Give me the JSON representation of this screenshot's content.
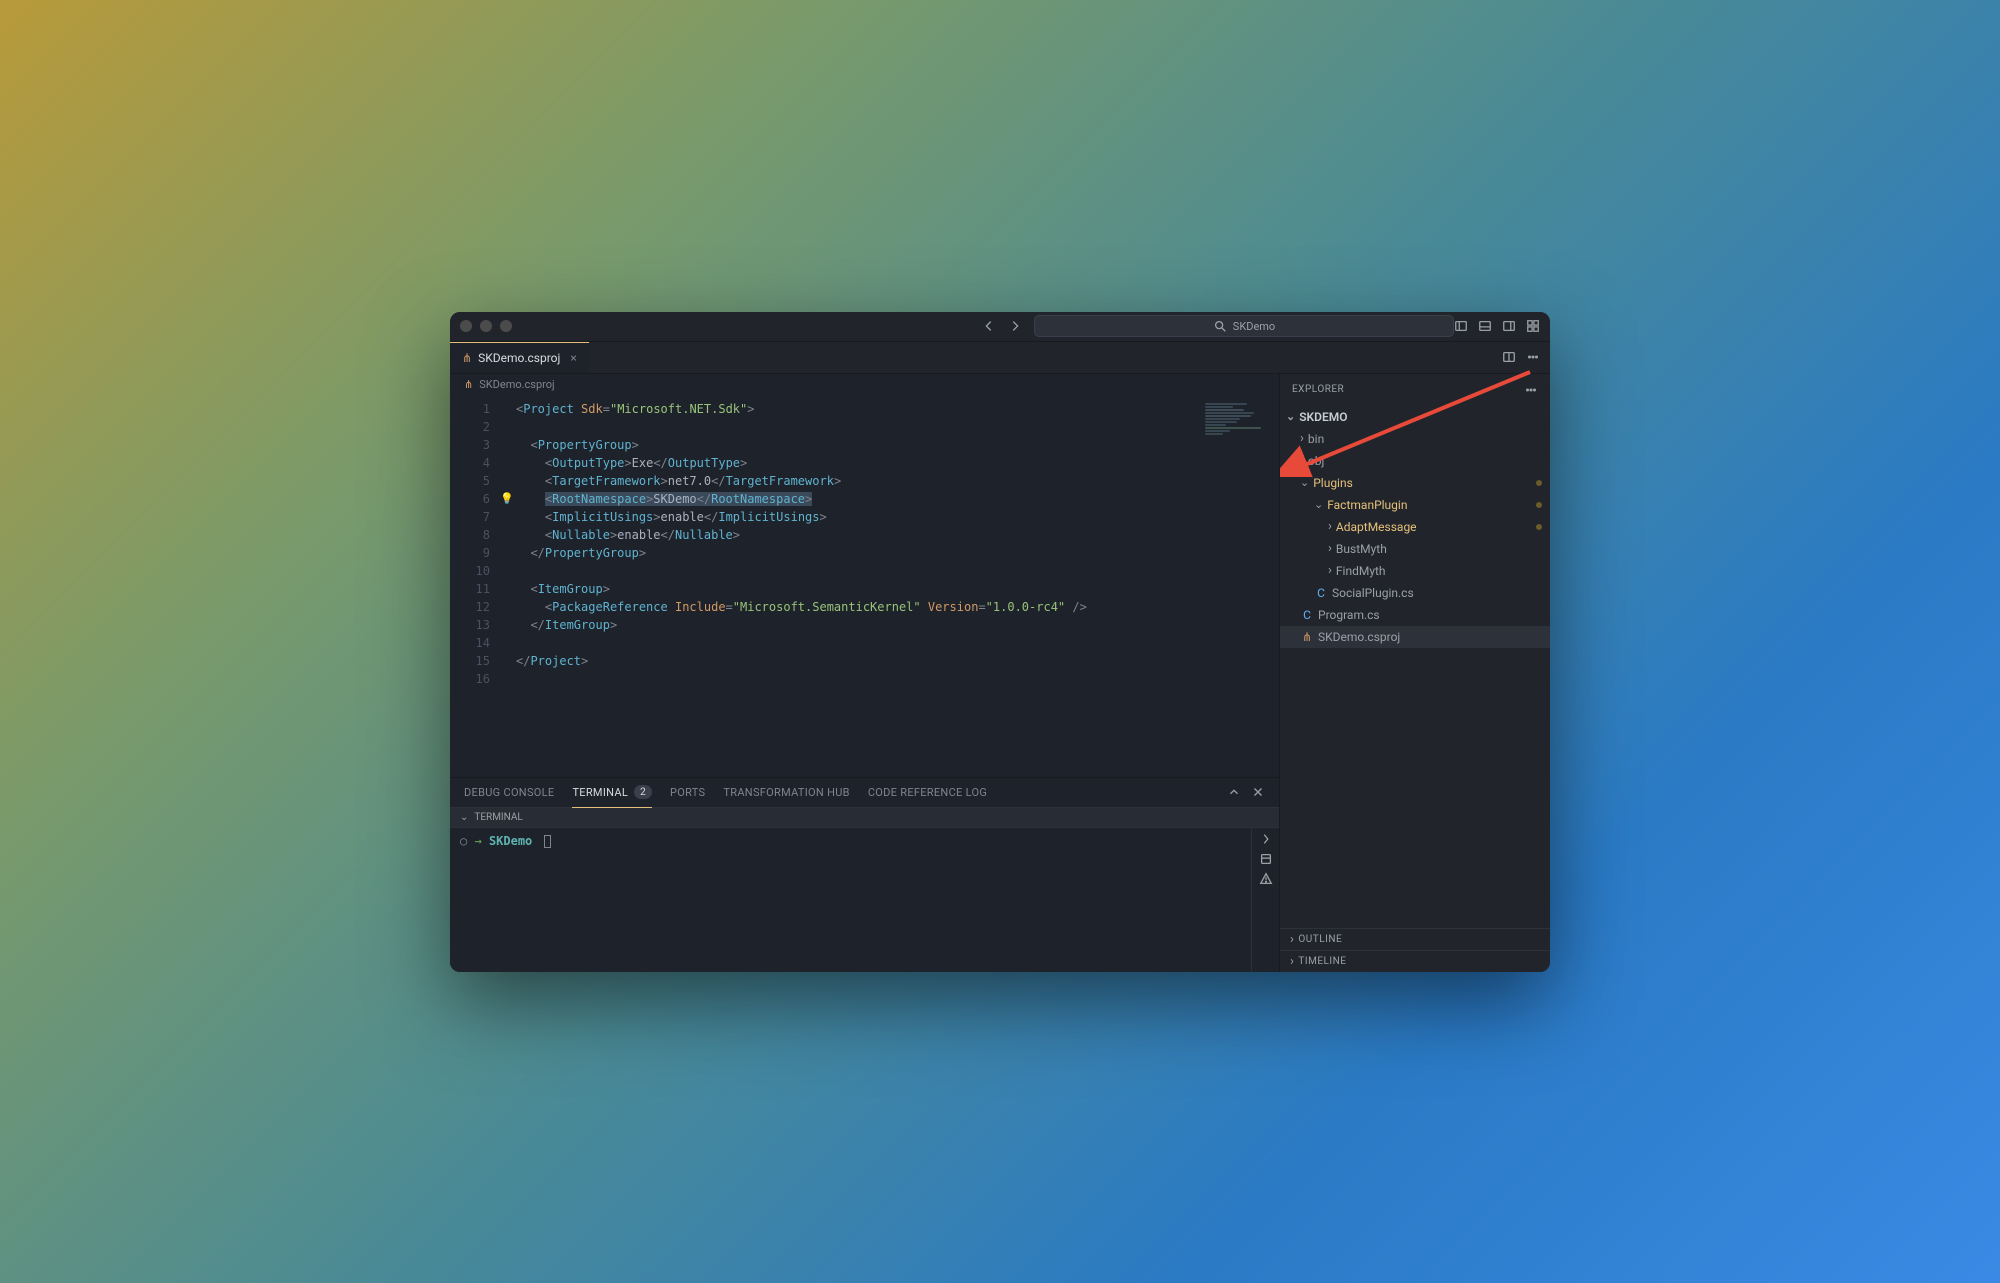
{
  "titlebar": {
    "search_placeholder": "SKDemo"
  },
  "tab": {
    "filename": "SKDemo.csproj",
    "close": "×"
  },
  "breadcrumb": {
    "filename": "SKDemo.csproj"
  },
  "code": {
    "lines": [
      {
        "n": 1,
        "html": "<span class='t-pun'>&lt;</span><span class='t-tag'>Project</span> <span class='t-attr'>Sdk</span><span class='t-pun'>=</span><span class='t-str'>\"Microsoft.NET.Sdk\"</span><span class='t-pun'>&gt;</span>"
      },
      {
        "n": 2,
        "html": ""
      },
      {
        "n": 3,
        "html": "  <span class='t-pun'>&lt;</span><span class='t-tag'>PropertyGroup</span><span class='t-pun'>&gt;</span>"
      },
      {
        "n": 4,
        "html": "    <span class='t-pun'>&lt;</span><span class='t-tag'>OutputType</span><span class='t-pun'>&gt;</span><span class='t-txt'>Exe</span><span class='t-pun'>&lt;/</span><span class='t-tag'>OutputType</span><span class='t-pun'>&gt;</span>"
      },
      {
        "n": 5,
        "html": "    <span class='t-pun'>&lt;</span><span class='t-tag'>TargetFramework</span><span class='t-pun'>&gt;</span><span class='t-txt'>net7.0</span><span class='t-pun'>&lt;/</span><span class='t-tag'>TargetFramework</span><span class='t-pun'>&gt;</span>"
      },
      {
        "n": 6,
        "html": "    <span class='hl'><span class='t-pun'>&lt;</span><span class='t-tag'>RootNamespace</span><span class='t-pun'>&gt;</span><span class='t-txt'>SKDemo</span><span class='t-pun'>&lt;/</span><span class='t-tag'>RootNamespace</span><span class='t-pun'>&gt;</span></span>",
        "bulb": true
      },
      {
        "n": 7,
        "html": "    <span class='t-pun'>&lt;</span><span class='t-tag'>ImplicitUsings</span><span class='t-pun'>&gt;</span><span class='t-txt'>enable</span><span class='t-pun'>&lt;/</span><span class='t-tag'>ImplicitUsings</span><span class='t-pun'>&gt;</span>"
      },
      {
        "n": 8,
        "html": "    <span class='t-pun'>&lt;</span><span class='t-tag'>Nullable</span><span class='t-pun'>&gt;</span><span class='t-txt'>enable</span><span class='t-pun'>&lt;/</span><span class='t-tag'>Nullable</span><span class='t-pun'>&gt;</span>"
      },
      {
        "n": 9,
        "html": "  <span class='t-pun'>&lt;/</span><span class='t-tag'>PropertyGroup</span><span class='t-pun'>&gt;</span>"
      },
      {
        "n": 10,
        "html": ""
      },
      {
        "n": 11,
        "html": "  <span class='t-pun'>&lt;</span><span class='t-tag'>ItemGroup</span><span class='t-pun'>&gt;</span>"
      },
      {
        "n": 12,
        "html": "    <span class='t-pun'>&lt;</span><span class='t-tag'>PackageReference</span> <span class='t-attr'>Include</span><span class='t-pun'>=</span><span class='t-str'>\"Microsoft.SemanticKernel\"</span> <span class='t-attr'>Version</span><span class='t-pun'>=</span><span class='t-str'>\"1.0.0-rc4\"</span> <span class='t-pun'>/&gt;</span>"
      },
      {
        "n": 13,
        "html": "  <span class='t-pun'>&lt;/</span><span class='t-tag'>ItemGroup</span><span class='t-pun'>&gt;</span>"
      },
      {
        "n": 14,
        "html": ""
      },
      {
        "n": 15,
        "html": "<span class='t-pun'>&lt;/</span><span class='t-tag'>Project</span><span class='t-pun'>&gt;</span>"
      },
      {
        "n": 16,
        "html": ""
      }
    ]
  },
  "panel": {
    "tabs": {
      "debug": "DEBUG CONSOLE",
      "terminal": "TERMINAL",
      "terminal_badge": "2",
      "ports": "PORTS",
      "transformation": "TRANSFORMATION HUB",
      "codelog": "CODE REFERENCE LOG"
    },
    "term_header": "TERMINAL",
    "term_prompt_dir": "SKDemo"
  },
  "explorer": {
    "title": "EXPLORER",
    "root": "SKDEMO",
    "items": [
      {
        "depth": 1,
        "type": "folder-closed",
        "label": "bin"
      },
      {
        "depth": 1,
        "type": "folder-closed",
        "label": "obj"
      },
      {
        "depth": 1,
        "type": "folder-open",
        "label": "Plugins",
        "yellow": true,
        "dot": true
      },
      {
        "depth": 2,
        "type": "folder-open",
        "label": "FactmanPlugin",
        "yellow": true,
        "dot": true
      },
      {
        "depth": 3,
        "type": "folder-closed",
        "label": "AdaptMessage",
        "yellow": true,
        "dot": true
      },
      {
        "depth": 3,
        "type": "folder-closed",
        "label": "BustMyth"
      },
      {
        "depth": 3,
        "type": "folder-closed",
        "label": "FindMyth"
      },
      {
        "depth": 2,
        "type": "file",
        "label": "SocialPlugin.cs",
        "icon": "cs"
      },
      {
        "depth": 1,
        "type": "file",
        "label": "Program.cs",
        "icon": "cs"
      },
      {
        "depth": 1,
        "type": "file",
        "label": "SKDemo.csproj",
        "icon": "rss",
        "selected": true
      }
    ],
    "outline": "OUTLINE",
    "timeline": "TIMELINE"
  }
}
